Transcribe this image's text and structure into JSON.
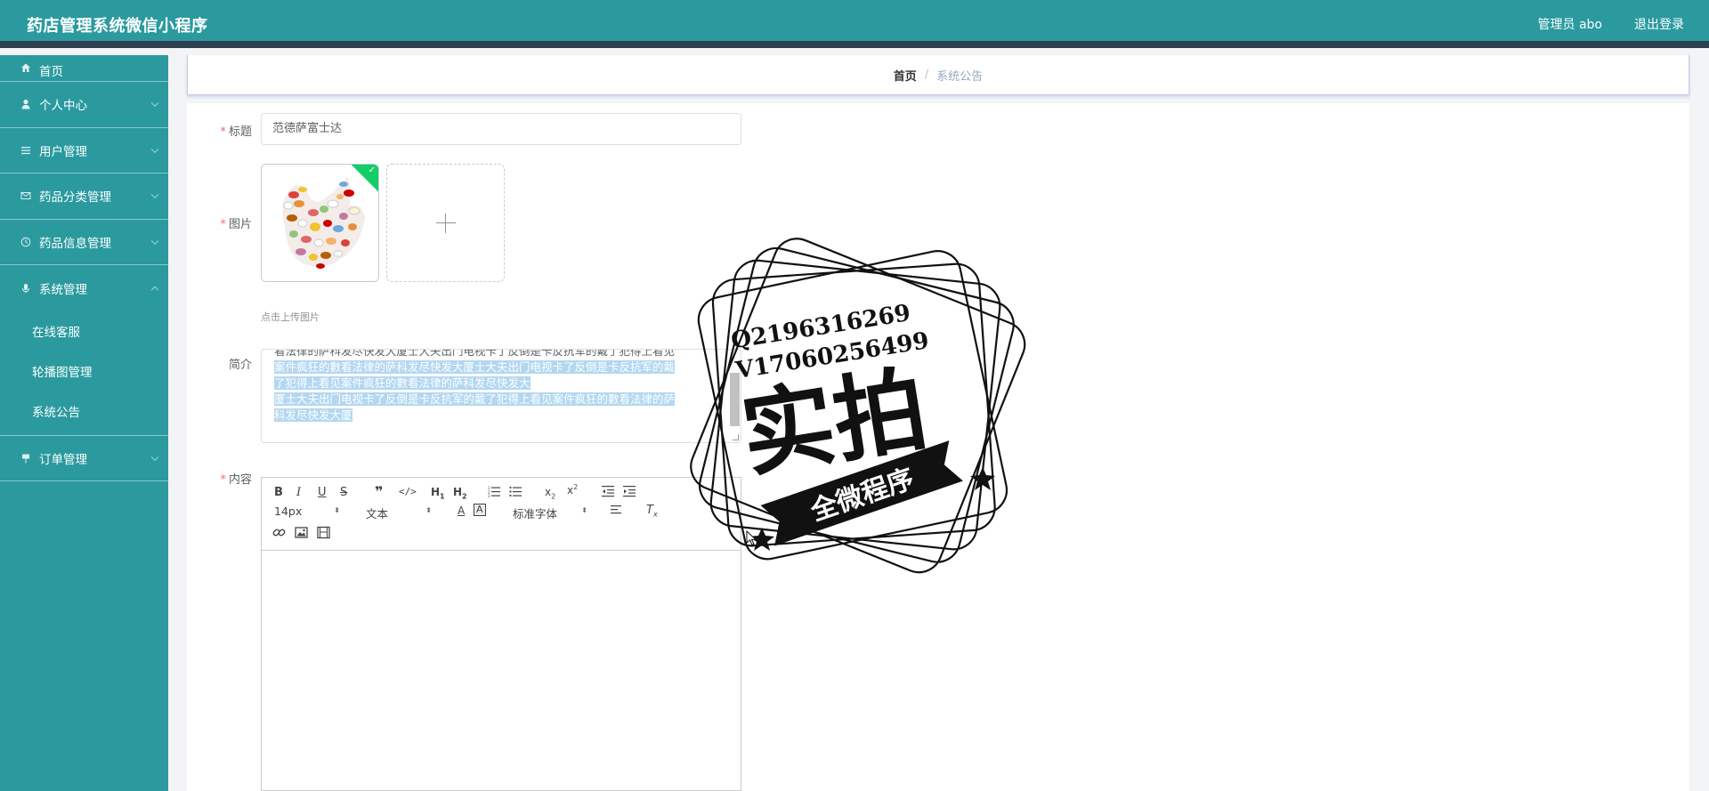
{
  "header": {
    "app_title": "药店管理系统微信小程序",
    "user_label": "管理员 abo",
    "logout_label": "退出登录"
  },
  "sidebar": {
    "items": [
      {
        "label": "首页",
        "icon": "home-icon"
      },
      {
        "label": "个人中心",
        "icon": "user-icon"
      },
      {
        "label": "用户管理",
        "icon": "list-icon"
      },
      {
        "label": "药品分类管理",
        "icon": "mail-icon"
      },
      {
        "label": "药品信息管理",
        "icon": "clock-icon"
      },
      {
        "label": "系统管理",
        "icon": "mic-icon"
      },
      {
        "label": "订单管理",
        "icon": "flag-icon"
      }
    ],
    "system_submenu": [
      "在线客服",
      "轮播图管理",
      "系统公告"
    ]
  },
  "breadcrumb": {
    "home": "首页",
    "separator": "/",
    "current": "系统公告"
  },
  "form": {
    "title_label": "标题",
    "title_value": "范德萨富士达",
    "image_label": "图片",
    "upload_tip": "点击上传图片",
    "intro_label": "简介",
    "intro_lines": [
      "看法律的萨科发尽快发大厦士大夫出门电视卡了反倒是卡反抗军的戴了犯得上看见",
      "案件疯狂的數看法律的萨科发尽快发大厦士大夫出门电视卡了反倒是卡反抗军的戴",
      "了犯得上看见案件疯狂的數看法律的萨科发尽快发大",
      " ",
      "厦士大夫出门电视卡了反倒是卡反抗军的戴了犯得上看见案件疯狂的數看法律的萨",
      "科发尽快发大厦"
    ],
    "content_label": "内容"
  },
  "editor": {
    "font_size": "14px",
    "text_type": "文本",
    "font_family": "标准字体"
  },
  "watermark": {
    "line1": "Q2196316269",
    "line2": "V17060256499",
    "big_text": "实拍",
    "ribbon_text": "全微程序"
  },
  "colors": {
    "teal": "#2a9a9f",
    "dark_strip": "#2f4050",
    "required": "#f56c6c",
    "upload_success": "#13ce66",
    "selection": "#b3d7f1"
  }
}
